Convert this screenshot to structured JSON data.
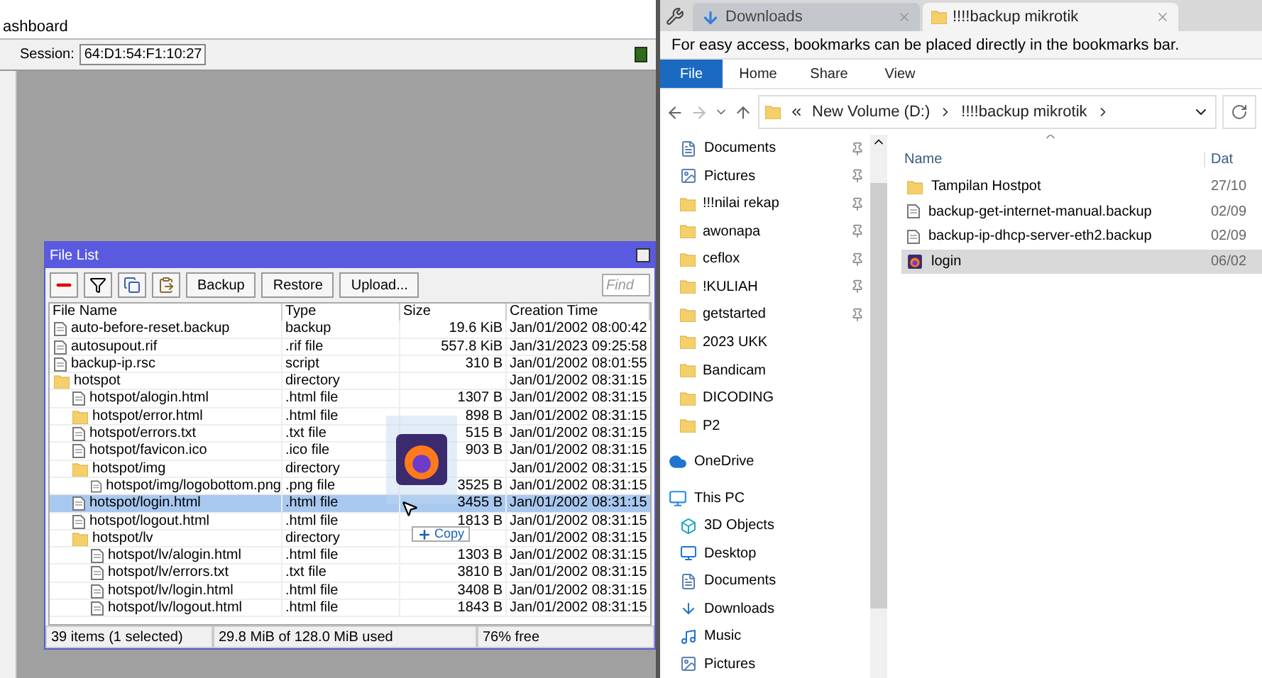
{
  "winbox": {
    "menu_label": "ashboard",
    "session_label": "Session:",
    "session_value": "64:D1:54:F1:10:27",
    "file_list": {
      "title": "File List",
      "toolbar_buttons": [
        "Backup",
        "Restore",
        "Upload..."
      ],
      "find_placeholder": "Find",
      "columns": [
        "File Name",
        "Type",
        "Size",
        "Creation Time"
      ],
      "rows": [
        {
          "kind": "file",
          "name": "auto-before-reset.backup",
          "type": "backup",
          "size": "19.6 KiB",
          "time": "Jan/01/2002 08:00:42",
          "selected": false
        },
        {
          "kind": "file",
          "name": "autosupout.rif",
          "type": ".rif file",
          "size": "557.8 KiB",
          "time": "Jan/31/2023 09:25:58",
          "selected": false
        },
        {
          "kind": "file",
          "name": "backup-ip.rsc",
          "type": "script",
          "size": "310 B",
          "time": "Jan/01/2002 08:01:55",
          "selected": false
        },
        {
          "kind": "folder",
          "name": "hotspot",
          "type": "directory",
          "time": "Jan/01/2002 08:31:15",
          "selected": false,
          "children": [
            {
              "kind": "file",
              "name": "hotspot/alogin.html",
              "type": ".html file",
              "size": "1307 B",
              "time": "Jan/01/2002 08:31:15",
              "selected": false
            },
            {
              "kind": "folder",
              "name": "hotspot/error.html",
              "type": ".html file",
              "size": "898 B",
              "time": "Jan/01/2002 08:31:15",
              "selected": false
            },
            {
              "kind": "file",
              "name": "hotspot/errors.txt",
              "type": ".txt file",
              "size": "515 B",
              "time": "Jan/01/2002 08:31:15",
              "selected": false
            },
            {
              "kind": "file",
              "name": "hotspot/favicon.ico",
              "type": ".ico file",
              "size": "903 B",
              "time": "Jan/01/2002 08:31:15",
              "selected": false
            },
            {
              "kind": "folder",
              "name": "hotspot/img",
              "type": "directory",
              "time": "Jan/01/2002 08:31:15",
              "selected": false,
              "children": [
                {
                  "kind": "file",
                  "name": "hotspot/img/logobottom.png",
                  "type": ".png file",
                  "size": "3525 B",
                  "time": "Jan/01/2002 08:31:15",
                  "selected": false
                }
              ]
            },
            {
              "kind": "file",
              "name": "hotspot/login.html",
              "type": ".html file",
              "size": "3455 B",
              "time": "Jan/01/2002 08:31:15",
              "selected": true
            },
            {
              "kind": "file",
              "name": "hotspot/logout.html",
              "type": ".html file",
              "size": "1813 B",
              "time": "Jan/01/2002 08:31:15",
              "selected": false
            },
            {
              "kind": "folder",
              "name": "hotspot/lv",
              "type": "directory",
              "time": "Jan/01/2002 08:31:15",
              "selected": false,
              "children": [
                {
                  "kind": "file",
                  "name": "hotspot/lv/alogin.html",
                  "type": ".html file",
                  "size": "1303 B",
                  "time": "Jan/01/2002 08:31:15",
                  "selected": false
                },
                {
                  "kind": "file",
                  "name": "hotspot/lv/errors.txt",
                  "type": ".txt file",
                  "size": "3810 B",
                  "time": "Jan/01/2002 08:31:15",
                  "selected": false
                },
                {
                  "kind": "file",
                  "name": "hotspot/lv/login.html",
                  "type": ".html file",
                  "size": "3408 B",
                  "time": "Jan/01/2002 08:31:15",
                  "selected": false
                },
                {
                  "kind": "file",
                  "name": "hotspot/lv/logout.html",
                  "type": ".html file",
                  "size": "1843 B",
                  "time": "Jan/01/2002 08:31:15",
                  "selected": false
                }
              ]
            }
          ]
        }
      ],
      "status": [
        "39 items (1 selected)",
        "29.8 MiB of 128.0 MiB used",
        "76% free"
      ]
    },
    "drag": {
      "label": "Copy"
    }
  },
  "browser": {
    "tabs": [
      {
        "kind": "download",
        "label": "Downloads",
        "selected": false
      },
      {
        "kind": "folder",
        "label": "!!!!backup mikrotik",
        "selected": true
      }
    ],
    "bookmark_notice": "For easy access, bookmarks can be placed directly in the bookmarks bar.",
    "ribbon_tabs": [
      {
        "label": "File",
        "selected": true
      },
      {
        "label": "Home",
        "selected": false
      },
      {
        "label": "Share",
        "selected": false
      },
      {
        "label": "View",
        "selected": false
      }
    ],
    "address": [
      "New Volume (D:)",
      "!!!!backup mikrotik"
    ],
    "nav": [
      {
        "kind": "documents",
        "label": "Documents",
        "pinned": true
      },
      {
        "kind": "pictures",
        "label": "Pictures",
        "pinned": true
      },
      {
        "kind": "folder",
        "label": "!!!nilai rekap",
        "pinned": true
      },
      {
        "kind": "folder",
        "label": "awonapa",
        "pinned": true
      },
      {
        "kind": "folder",
        "label": "ceflox",
        "pinned": true
      },
      {
        "kind": "folder",
        "label": "!KULIAH",
        "pinned": true
      },
      {
        "kind": "folder",
        "label": "getstarted",
        "pinned": true
      },
      {
        "kind": "folder",
        "label": "2023 UKK",
        "pinned": false
      },
      {
        "kind": "folder",
        "label": "Bandicam",
        "pinned": false
      },
      {
        "kind": "folder",
        "label": "DICODING",
        "pinned": false
      },
      {
        "kind": "folder",
        "label": "P2",
        "pinned": false
      },
      {
        "kind": "onedrive",
        "label": "OneDrive",
        "pinned": false
      },
      {
        "kind": "pc",
        "label": "This PC",
        "pinned": false
      },
      {
        "kind": "cube",
        "label": "3D Objects",
        "pinned": false
      },
      {
        "kind": "desktop",
        "label": "Desktop",
        "pinned": false
      },
      {
        "kind": "documents",
        "label": "Documents",
        "pinned": false
      },
      {
        "kind": "download",
        "label": "Downloads",
        "pinned": false
      },
      {
        "kind": "music",
        "label": "Music",
        "pinned": false
      },
      {
        "kind": "pictures",
        "label": "Pictures",
        "pinned": false
      }
    ],
    "columns": [
      "Name",
      "Dat"
    ],
    "files": [
      {
        "kind": "folder",
        "name": "Tampilan Hostpot",
        "date": "27/10",
        "selected": false
      },
      {
        "kind": "file",
        "name": "backup-get-internet-manual.backup",
        "date": "02/09",
        "selected": false
      },
      {
        "kind": "file",
        "name": "backup-ip-dhcp-server-eth2.backup",
        "date": "02/09",
        "selected": false
      },
      {
        "kind": "firefox",
        "name": "login",
        "date": "06/02",
        "selected": true
      }
    ]
  }
}
